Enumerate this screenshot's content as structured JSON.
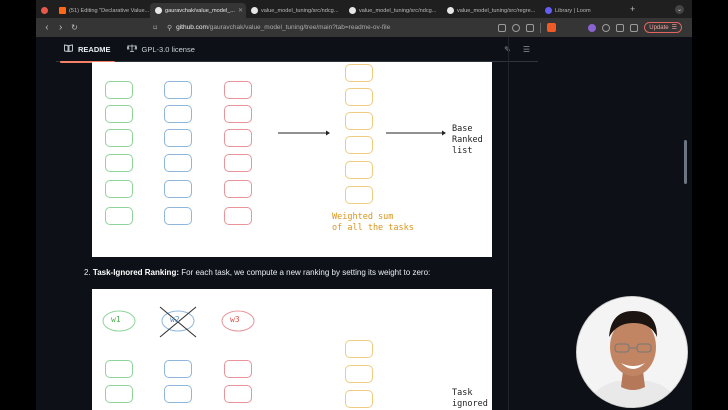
{
  "browser": {
    "tabs": [
      {
        "title": "",
        "icon": "record-icon",
        "color": "#e8594b",
        "active": false
      },
      {
        "title": "(51) Editing \"Declarative Value...",
        "icon": "substack-icon",
        "color": "#ff6719",
        "active": false
      },
      {
        "title": "gauravchak/value_model_...",
        "icon": "github-icon",
        "color": "#e6e6e6",
        "active": true
      },
      {
        "title": "value_model_tuning/src/ndcg...",
        "icon": "github-icon",
        "color": "#e6e6e6",
        "active": false
      },
      {
        "title": "value_model_tuning/src/ndcg...",
        "icon": "github-icon",
        "color": "#e6e6e6",
        "active": false
      },
      {
        "title": "value_model_tuning/src/regre...",
        "icon": "github-icon",
        "color": "#e6e6e6",
        "active": false
      },
      {
        "title": "Library | Loom",
        "icon": "loom-icon",
        "color": "#625df5",
        "active": false
      }
    ],
    "new_tab": "+",
    "url_host": "github.com",
    "url_path": "/gauravchak/value_model_tuning/tree/main?tab=readme-ov-file",
    "update_label": "Update",
    "accent": "#e2645f"
  },
  "readme": {
    "tabs": [
      {
        "label": "README",
        "icon": "book-icon",
        "active": true
      },
      {
        "label": "GPL-3.0 license",
        "icon": "scale-icon",
        "active": false
      }
    ],
    "edit_icon": "pencil-icon",
    "toc_icon": "list-icon",
    "accent": "#f78166"
  },
  "diagram1": {
    "label_base_ranked": [
      "Base",
      "Ranked",
      "list"
    ],
    "label_weighted": [
      "Weighted sum",
      "of all the tasks"
    ],
    "weighted_color": "#d9951f"
  },
  "section2": {
    "number": "2.",
    "title": "Task-Ignored Ranking:",
    "text": " For each task, we compute a new ranking by setting its weight to zero:"
  },
  "diagram2": {
    "weights": [
      "w1",
      "w2",
      "w3"
    ],
    "label_task_ignored": [
      "Task",
      "ignored"
    ]
  },
  "webcam": {
    "label": "presenter-webcam"
  }
}
